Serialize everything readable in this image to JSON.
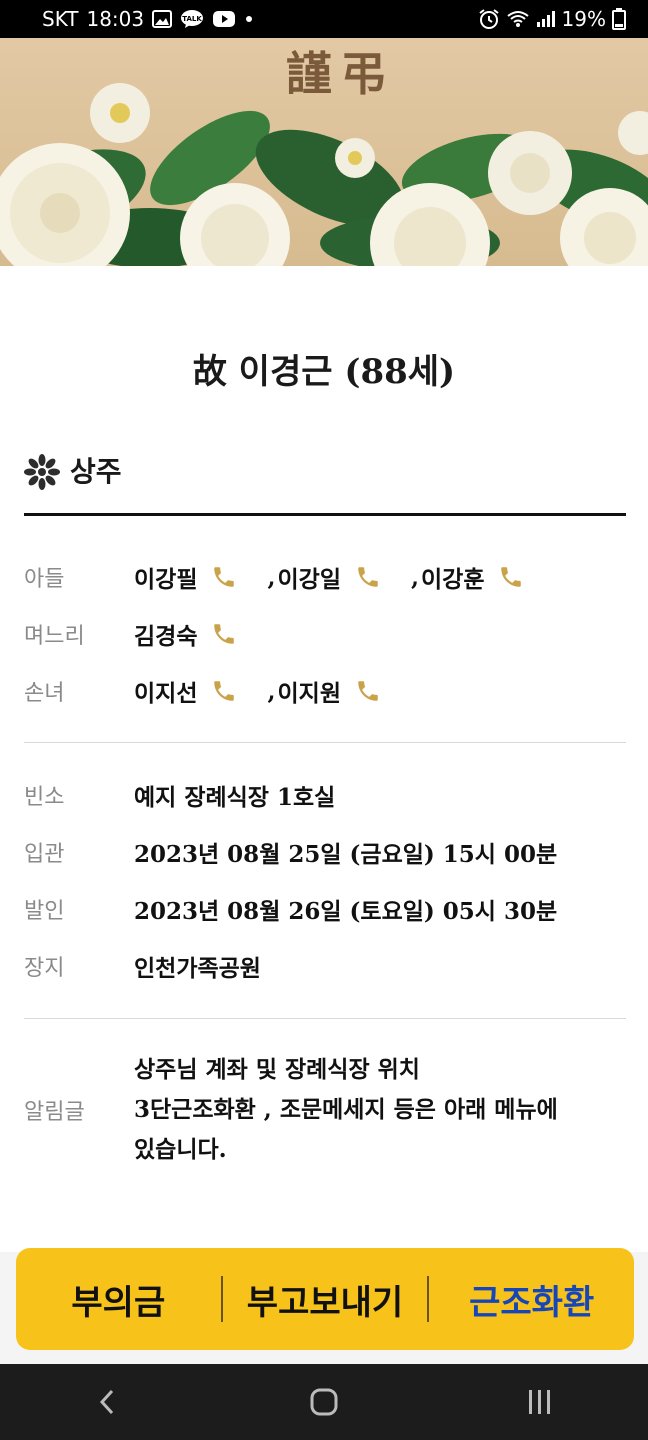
{
  "status_bar": {
    "carrier": "SKT",
    "time": "18:03",
    "battery": "19%",
    "left_icons": [
      "gallery-icon",
      "kakaotalk-icon",
      "youtube-icon",
      "dot-icon"
    ],
    "right_icons": [
      "alarm-icon",
      "wifi-icon",
      "signal-icon",
      "battery-icon"
    ]
  },
  "banner": {
    "title": "謹弔"
  },
  "deceased": {
    "title": "故 이경근 (88세)"
  },
  "mourners_section": {
    "title": "상주",
    "icon": "chrysanthemum-icon"
  },
  "mourners": [
    {
      "label": "아들",
      "names": [
        "이강필",
        "이강일",
        "이강훈"
      ]
    },
    {
      "label": "며느리",
      "names": [
        "김경숙"
      ]
    },
    {
      "label": "손녀",
      "names": [
        "이지선",
        "이지원"
      ]
    }
  ],
  "separator": ",",
  "funeral_info": [
    {
      "label": "빈소",
      "value": "예지 장례식장 1호실"
    },
    {
      "label": "입관",
      "value": "2023년 08월 25일 (금요일) 15시 00분"
    },
    {
      "label": "발인",
      "value": "2023년 08월 26일 (토요일) 05시 30분"
    },
    {
      "label": "장지",
      "value": "인천가족공원"
    }
  ],
  "notice": {
    "label": "알림글",
    "lines": [
      "상주님 계좌 및 장례식장 위치",
      "3단근조화환 , 조문메세지 등은 아래 메뉴에",
      "있습니다."
    ]
  },
  "actions": [
    {
      "label": "부의금",
      "highlight": false
    },
    {
      "label": "부고보내기",
      "highlight": false
    },
    {
      "label": "근조화환",
      "highlight": true
    }
  ],
  "colors": {
    "accent_yellow": "#f7c31a",
    "highlight_blue": "#1746b8",
    "phone_gold": "#c9a24a",
    "banner_bg": "#d9bf96"
  },
  "nav": [
    "back-icon",
    "home-icon",
    "recent-apps-icon"
  ]
}
